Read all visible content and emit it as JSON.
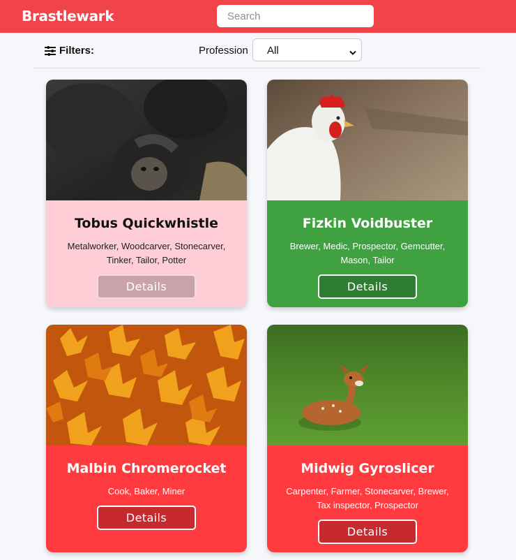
{
  "header": {
    "brand": "Brastlewark",
    "search_placeholder": "Search",
    "search_value": ""
  },
  "filters": {
    "label": "Filters:",
    "icon": "sliders-icon",
    "profession_label": "Profession",
    "profession_selected": "All"
  },
  "colors": {
    "header_bg": "#f1434a",
    "pink_card": "#ffcdd5",
    "green_card": "#3fa140",
    "red_card": "#ff3b3f"
  },
  "cards": [
    {
      "name": "Tobus Quickwhistle",
      "professions": "Metalworker, Woodcarver, Stonecarver, Tinker, Tailor, Potter",
      "button": "Details",
      "photo": "chimpanzees-photo"
    },
    {
      "name": "Fizkin Voidbuster",
      "professions": "Brewer, Medic, Prospector, Gemcutter, Mason, Tailor",
      "button": "Details",
      "photo": "white-hen-photo"
    },
    {
      "name": "Malbin Chromerocket",
      "professions": "Cook, Baker, Miner",
      "button": "Details",
      "photo": "autumn-leaves-photo"
    },
    {
      "name": "Midwig Gyroslicer",
      "professions": "Carpenter, Farmer, Stonecarver, Brewer, Tax inspector, Prospector",
      "button": "Details",
      "photo": "fawn-on-grass-photo"
    }
  ]
}
